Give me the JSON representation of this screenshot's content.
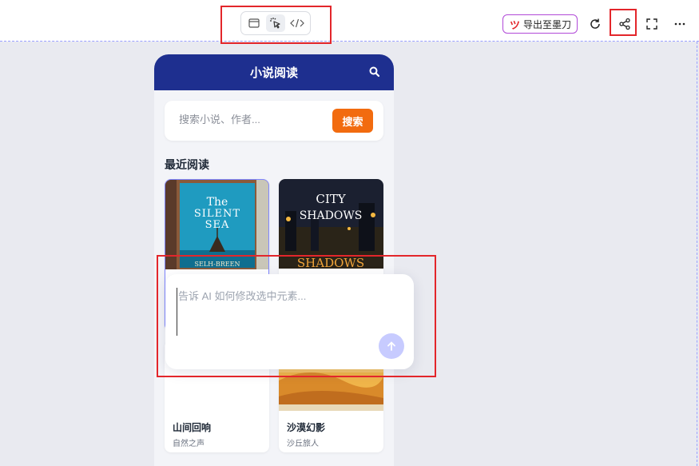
{
  "toolbar": {
    "modes": [
      {
        "name": "preview",
        "icon": "window-icon",
        "active": false
      },
      {
        "name": "select",
        "icon": "pointer-click-icon",
        "active": true
      },
      {
        "name": "code",
        "icon": "code-icon",
        "active": false
      }
    ],
    "export_label": "导出至墨刀",
    "export_logo": "ツ",
    "actions": [
      "refresh-icon",
      "share-icon",
      "fullscreen-icon",
      "more-icon"
    ]
  },
  "app": {
    "title": "小说阅读",
    "search_placeholder": "搜索小说、作者...",
    "search_button": "搜索",
    "recent_title": "最近阅读",
    "books": [
      {
        "cover_line1": "The",
        "cover_line2": "SILENT",
        "cover_line3": "SEA",
        "cover_author": "SELH-BREEN",
        "title": "",
        "author": ""
      },
      {
        "cover_line1": "CITY",
        "cover_line2": "SHADOWS",
        "cover_line3": "SHADOWS",
        "title": "",
        "author": ""
      },
      {
        "title": "山间回响",
        "author": "自然之声"
      },
      {
        "title": "沙漠幻影",
        "author": "沙丘旅人"
      }
    ]
  },
  "ai_prompt": {
    "placeholder": "告诉 AI 如何修改选中元素..."
  },
  "colors": {
    "header_bg": "#1e2f8f",
    "accent_orange": "#f26b0f",
    "highlight_red": "#e3262b",
    "send_disabled": "#c7cbff"
  }
}
